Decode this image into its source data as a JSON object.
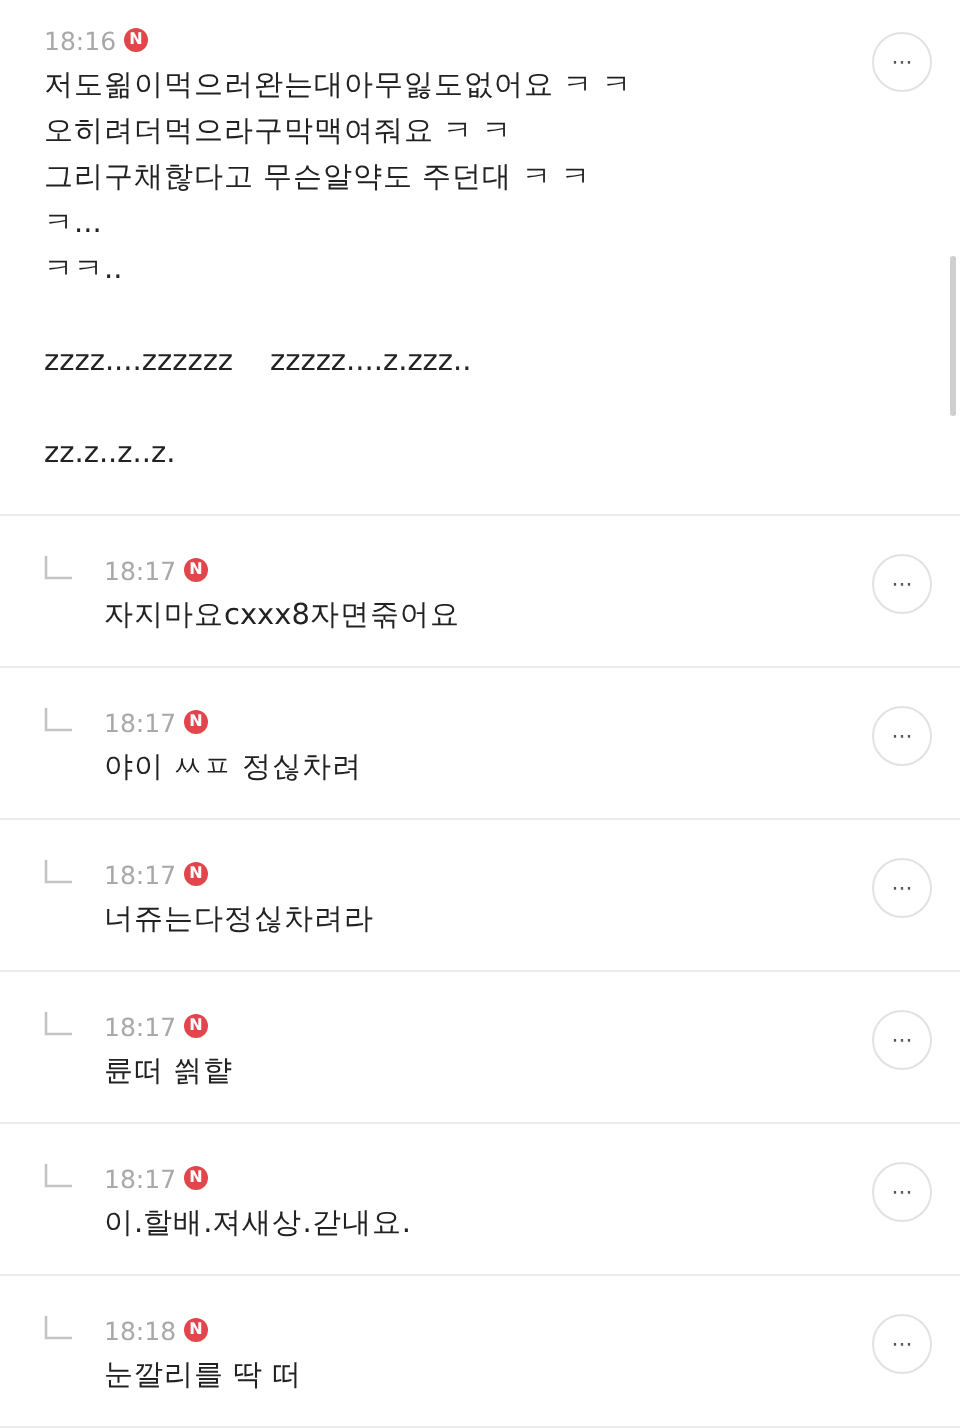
{
  "comments": [
    {
      "kind": "comment",
      "time": "18:16",
      "badge": "N",
      "paragraphs": [
        {
          "lines": [
            "저도욂이먹으러완는대아무잃도없어요 ㅋ ㅋ",
            "오히려더먹으라구막맥여줘요 ㅋ ㅋ",
            "그리구채핞다고 무슨알약도 주던대 ㅋ ㅋ",
            "ㅋ...",
            "ㅋㅋ.."
          ]
        },
        {
          "lines": [
            "zzzz....zzzzzz    zzzzz....z.zzz.."
          ]
        },
        {
          "lines": [
            "zz.z..z..z."
          ]
        }
      ],
      "more": "···"
    },
    {
      "kind": "reply",
      "time": "18:17",
      "badge": "N",
      "paragraphs": [
        {
          "lines": [
            "자지마요cxxx8자면죾어요"
          ]
        }
      ],
      "more": "···"
    },
    {
      "kind": "reply",
      "time": "18:17",
      "badge": "N",
      "paragraphs": [
        {
          "lines": [
            "야이 ㅆㅍ 정싢차려"
          ]
        }
      ],
      "more": "···"
    },
    {
      "kind": "reply",
      "time": "18:17",
      "badge": "N",
      "paragraphs": [
        {
          "lines": [
            "너쥬는다정싢차려라"
          ]
        }
      ],
      "more": "···"
    },
    {
      "kind": "reply",
      "time": "18:17",
      "badge": "N",
      "paragraphs": [
        {
          "lines": [
            "륜떠 씕햩"
          ]
        }
      ],
      "more": "···"
    },
    {
      "kind": "reply",
      "time": "18:17",
      "badge": "N",
      "paragraphs": [
        {
          "lines": [
            "이.할배.져새상.갇내요."
          ]
        }
      ],
      "more": "···"
    },
    {
      "kind": "reply",
      "time": "18:18",
      "badge": "N",
      "paragraphs": [
        {
          "lines": [
            "눈깔리를 딱 떠"
          ]
        }
      ],
      "more": "···"
    }
  ]
}
